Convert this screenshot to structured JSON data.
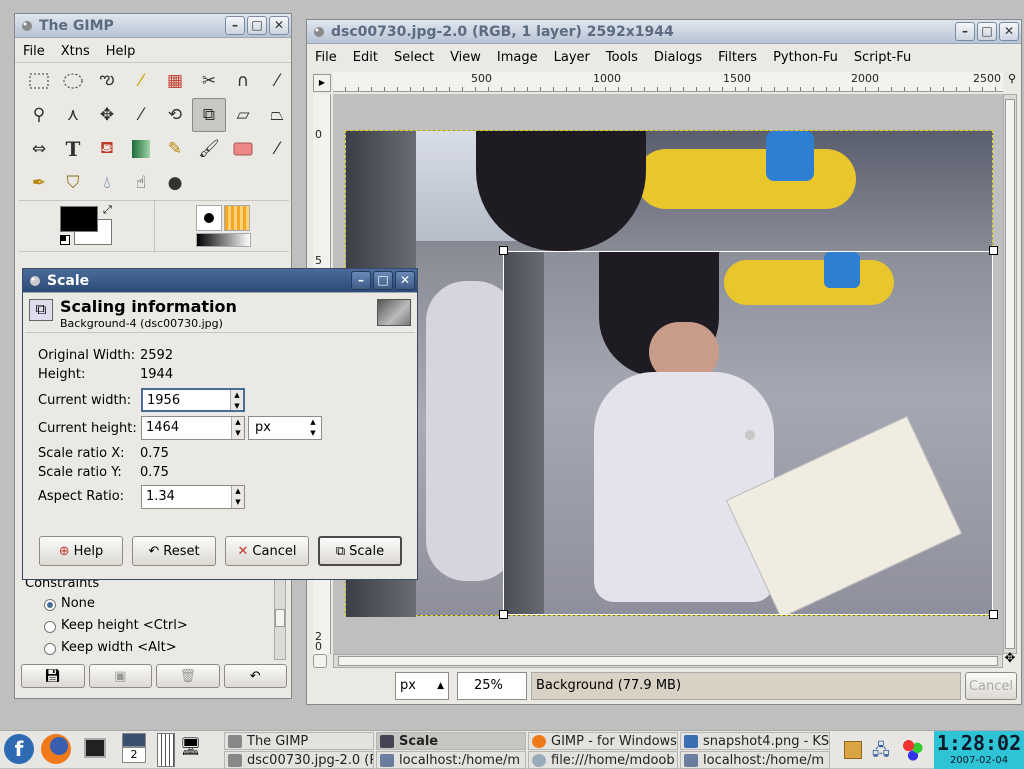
{
  "toolbox": {
    "title": "The GIMP",
    "menu": [
      "File",
      "Xtns",
      "Help"
    ],
    "constraints_label": "Constraints",
    "constraints": [
      {
        "label": "None",
        "selected": true
      },
      {
        "label": "Keep height  <Ctrl>",
        "selected": false
      },
      {
        "label": "Keep width  <Alt>",
        "selected": false
      }
    ]
  },
  "image_window": {
    "title": "dsc00730.jpg-2.0 (RGB, 1 layer) 2592x1944",
    "menu": [
      "File",
      "Edit",
      "Select",
      "View",
      "Image",
      "Layer",
      "Tools",
      "Dialogs",
      "Filters",
      "Python-Fu",
      "Script-Fu"
    ],
    "ruler_h": [
      "500",
      "1000",
      "1500",
      "2000",
      "2500"
    ],
    "ruler_v": [
      "0",
      "5",
      "2",
      "0"
    ],
    "status": {
      "unit": "px",
      "zoom": "25%",
      "layer_info": "Background (77.9 MB)",
      "cancel_label": "Cancel"
    }
  },
  "scale_dialog": {
    "title": "Scale",
    "header_title": "Scaling information",
    "header_subtitle": "Background-4 (dsc00730.jpg)",
    "original_width_label": "Original Width:",
    "original_width": "2592",
    "height_label": "Height:",
    "height": "1944",
    "current_width_label": "Current width:",
    "current_width": "1956",
    "current_height_label": "Current height:",
    "current_height": "1464",
    "unit": "px",
    "ratio_x_label": "Scale ratio X:",
    "ratio_x": "0.75",
    "ratio_y_label": "Scale ratio Y:",
    "ratio_y": "0.75",
    "aspect_label": "Aspect Ratio:",
    "aspect": "1.34",
    "buttons": {
      "help": "Help",
      "reset": "Reset",
      "cancel": "Cancel",
      "scale": "Scale"
    }
  },
  "taskbar": {
    "tasks": [
      {
        "label": "The GIMP",
        "active": false
      },
      {
        "label": "Scale",
        "active": true
      },
      {
        "label": "GIMP - for Windows",
        "active": false
      },
      {
        "label": "snapshot4.png - KS",
        "active": false
      },
      {
        "label": "dsc00730.jpg-2.0 (R",
        "active": false
      },
      {
        "label": "localhost:/home/m",
        "active": false
      },
      {
        "label": "file:///home/mdoob",
        "active": false
      },
      {
        "label": "localhost:/home/m",
        "active": false
      }
    ],
    "pager_number": "2",
    "clock_time": "1:28:02",
    "clock_date": "2007-02-04"
  },
  "colors": {
    "accent": "#2d4a74",
    "clock_bg": "#2ec4d6",
    "selection": "#000000"
  }
}
